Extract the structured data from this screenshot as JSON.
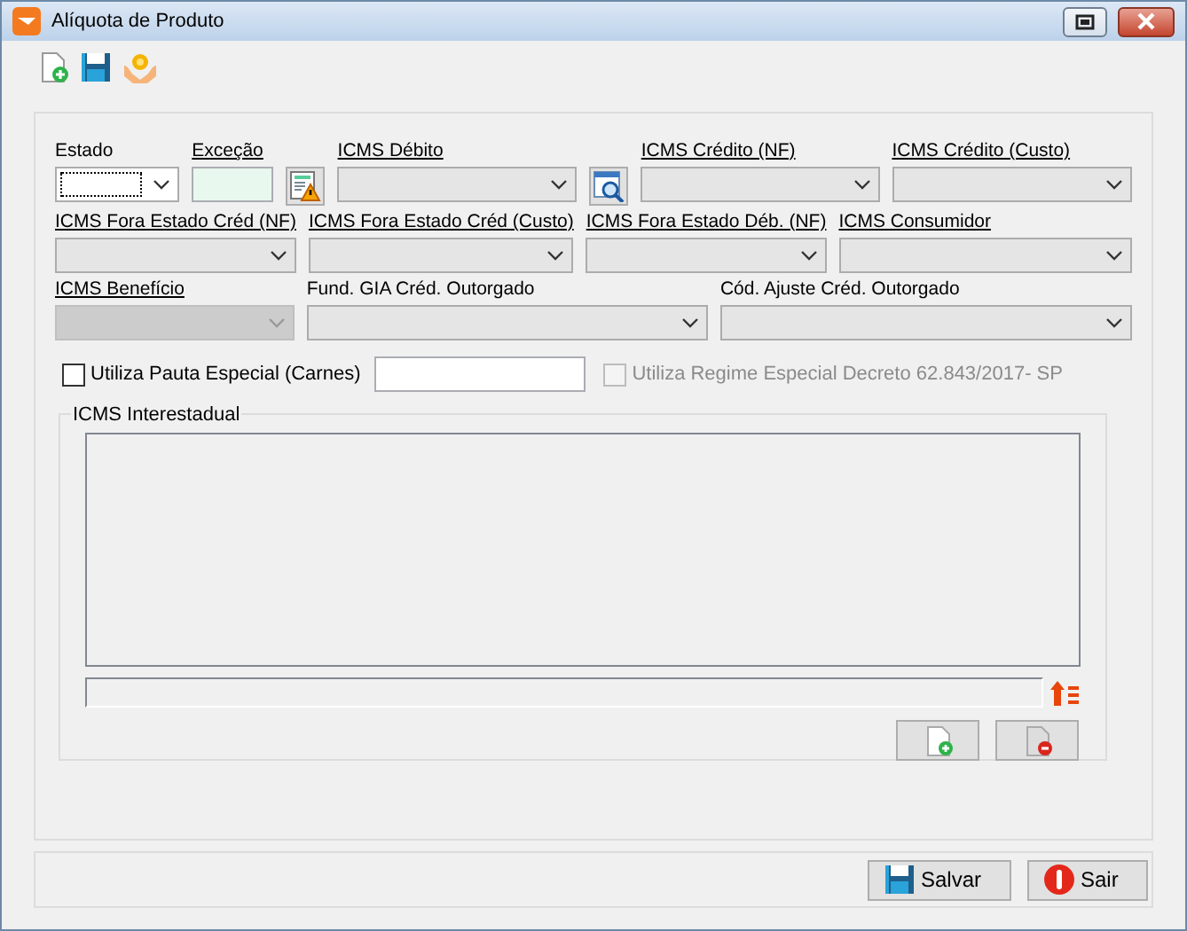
{
  "window": {
    "title": "Alíquota de Produto"
  },
  "fields": [
    {
      "kind": "select",
      "label": "Estado",
      "underlined": false,
      "focused": true,
      "disabled": false
    },
    {
      "kind": "text",
      "label": "Exceção",
      "underlined": true,
      "focused": false,
      "disabled": false
    },
    {
      "kind": "warning-button"
    },
    {
      "kind": "select",
      "label": "ICMS Débito",
      "underlined": true,
      "focused": false,
      "disabled": false
    },
    {
      "kind": "search-button"
    },
    {
      "kind": "select",
      "label": "ICMS Crédito (NF)",
      "underlined": true,
      "focused": false,
      "disabled": false
    },
    {
      "kind": "select",
      "label": "ICMS Crédito (Custo)",
      "underlined": true,
      "focused": false,
      "disabled": false
    },
    {
      "kind": "select",
      "label": "ICMS Fora Estado Créd (NF)",
      "underlined": true,
      "focused": false,
      "disabled": false
    },
    {
      "kind": "select",
      "label": "ICMS Fora Estado Créd (Custo)",
      "underlined": true,
      "focused": false,
      "disabled": false
    },
    {
      "kind": "select",
      "label": "ICMS Fora Estado Déb. (NF)",
      "underlined": true,
      "focused": false,
      "disabled": false
    },
    {
      "kind": "select",
      "label": "ICMS Consumidor",
      "underlined": true,
      "focused": false,
      "disabled": false
    },
    {
      "kind": "select",
      "label": "ICMS Benefício",
      "underlined": true,
      "focused": false,
      "disabled": true
    },
    {
      "kind": "select",
      "label": "Fund. GIA Créd. Outorgado",
      "underlined": false,
      "focused": false,
      "disabled": false
    },
    {
      "kind": "select",
      "label": "Cód. Ajuste Créd. Outorgado",
      "underlined": false,
      "focused": false,
      "disabled": false
    }
  ],
  "pauta": {
    "label": "Utiliza Pauta Especial (Carnes)",
    "checked": false
  },
  "regime": {
    "label": "Utiliza Regime Especial Decreto 62.843/2017- SP",
    "checked": false,
    "disabled": true
  },
  "interestadual": {
    "title": "ICMS Interestadual"
  },
  "footer_buttons": [
    {
      "kind": "save",
      "label": "Salvar"
    },
    {
      "kind": "exit",
      "label": "Sair"
    }
  ]
}
